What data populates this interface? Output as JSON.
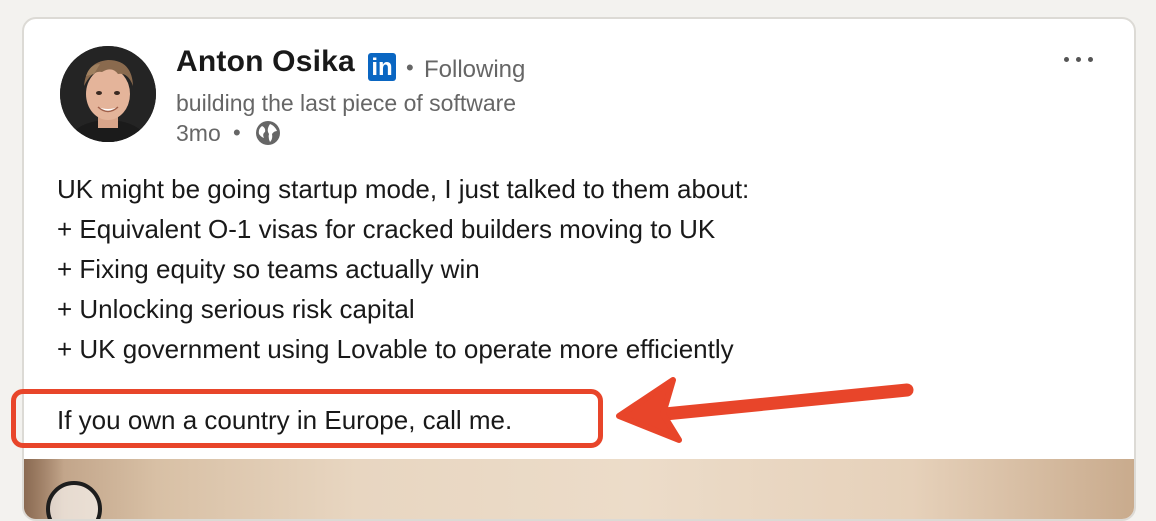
{
  "post": {
    "author": {
      "name": "Anton Osika",
      "badge": "in",
      "following": "Following",
      "headline": "building the last piece of software",
      "time": "3mo",
      "separator": "•",
      "visibility_icon": "globe-icon"
    },
    "menu_icon": "more-options-icon",
    "body_lines": [
      "UK might be going startup mode, I just talked to them about:",
      "+ Equivalent O-1 visas for cracked builders moving to UK",
      "+ Fixing equity so teams actually win",
      "+ Unlocking serious risk capital",
      "+ UK government using Lovable to operate more efficiently"
    ],
    "closing_line": "If you own a country in Europe, call me."
  },
  "annotation": {
    "color": "#e8452a",
    "shapes": [
      "highlight-box",
      "arrow"
    ]
  },
  "colors": {
    "linkedin_blue": "#0a66c2",
    "text_primary": "#191919",
    "text_secondary": "#666666",
    "background": "#f3f2ef"
  }
}
